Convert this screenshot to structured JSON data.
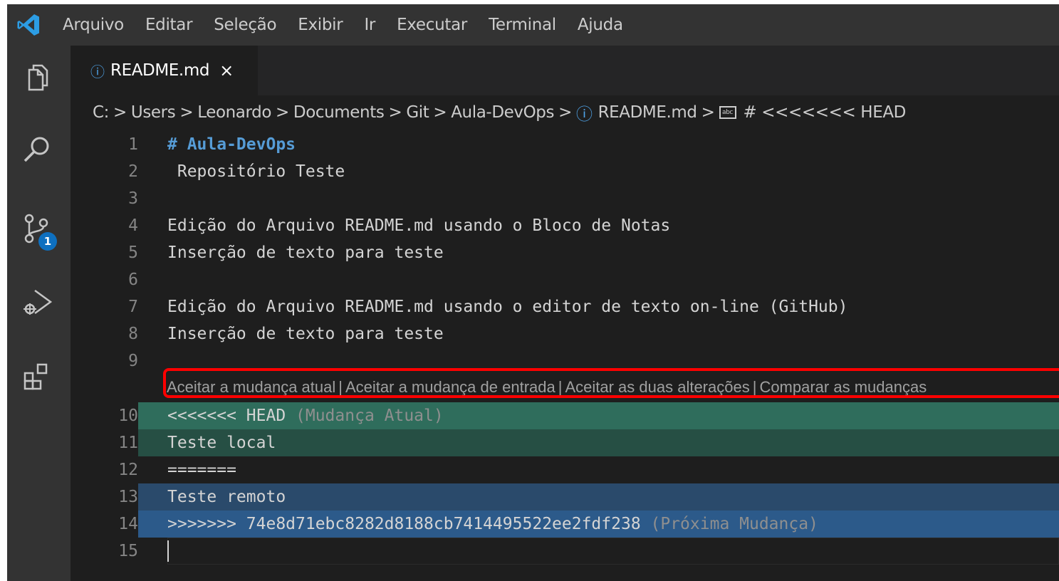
{
  "menubar": {
    "logo": "vscode-logo-icon",
    "items": [
      "Arquivo",
      "Editar",
      "Seleção",
      "Exibir",
      "Ir",
      "Executar",
      "Terminal",
      "Ajuda"
    ]
  },
  "activitybar": {
    "icons": [
      "explorer-icon",
      "search-icon",
      "source-control-icon",
      "run-debug-icon",
      "extensions-icon"
    ],
    "source_control_badge": "1"
  },
  "tab": {
    "icon": "info-icon",
    "label": "README.md",
    "close": "×"
  },
  "breadcrumb": {
    "items": [
      "C:",
      "Users",
      "Leonardo",
      "Documents",
      "Git",
      "Aula-DevOps",
      "README.md",
      "# <<<<<<< HEAD"
    ],
    "separator": ">"
  },
  "editor": {
    "lines": [
      {
        "num": "1",
        "text": "# Aula-DevOps"
      },
      {
        "num": "2",
        "text": " Repositório Teste"
      },
      {
        "num": "3",
        "text": ""
      },
      {
        "num": "4",
        "text": "Edição do Arquivo README.md usando o Bloco de Notas"
      },
      {
        "num": "5",
        "text": "Inserção de texto para teste"
      },
      {
        "num": "6",
        "text": ""
      },
      {
        "num": "7",
        "text": "Edição do Arquivo README.md usando o editor de texto on-line (GitHub)"
      },
      {
        "num": "8",
        "text": "Inserção de texto para teste"
      },
      {
        "num": "9",
        "text": ""
      },
      {
        "num": "10",
        "text": "<<<<<<< HEAD",
        "suffix": " (Mudança Atual)"
      },
      {
        "num": "11",
        "text": "Teste local"
      },
      {
        "num": "12",
        "text": "======="
      },
      {
        "num": "13",
        "text": "Teste remoto"
      },
      {
        "num": "14",
        "text": ">>>>>>> 74e8d71ebc8282d8188cb7414495522ee2fdf238",
        "suffix": " (Próxima Mudança)"
      },
      {
        "num": "15",
        "text": ""
      }
    ],
    "codelens": {
      "accept_current": "Aceitar a mudança atual",
      "accept_incoming": "Aceitar a mudança de entrada",
      "accept_both": "Aceitar as duas alterações",
      "compare": "Comparar as mudanças",
      "separator": "|"
    }
  },
  "colors": {
    "current_change_header": "#2f6d5c",
    "current_change": "#264f44",
    "incoming_change": "#2a4a6b",
    "incoming_change_header": "#2c5a8a",
    "highlight_box": "#ff0000"
  }
}
